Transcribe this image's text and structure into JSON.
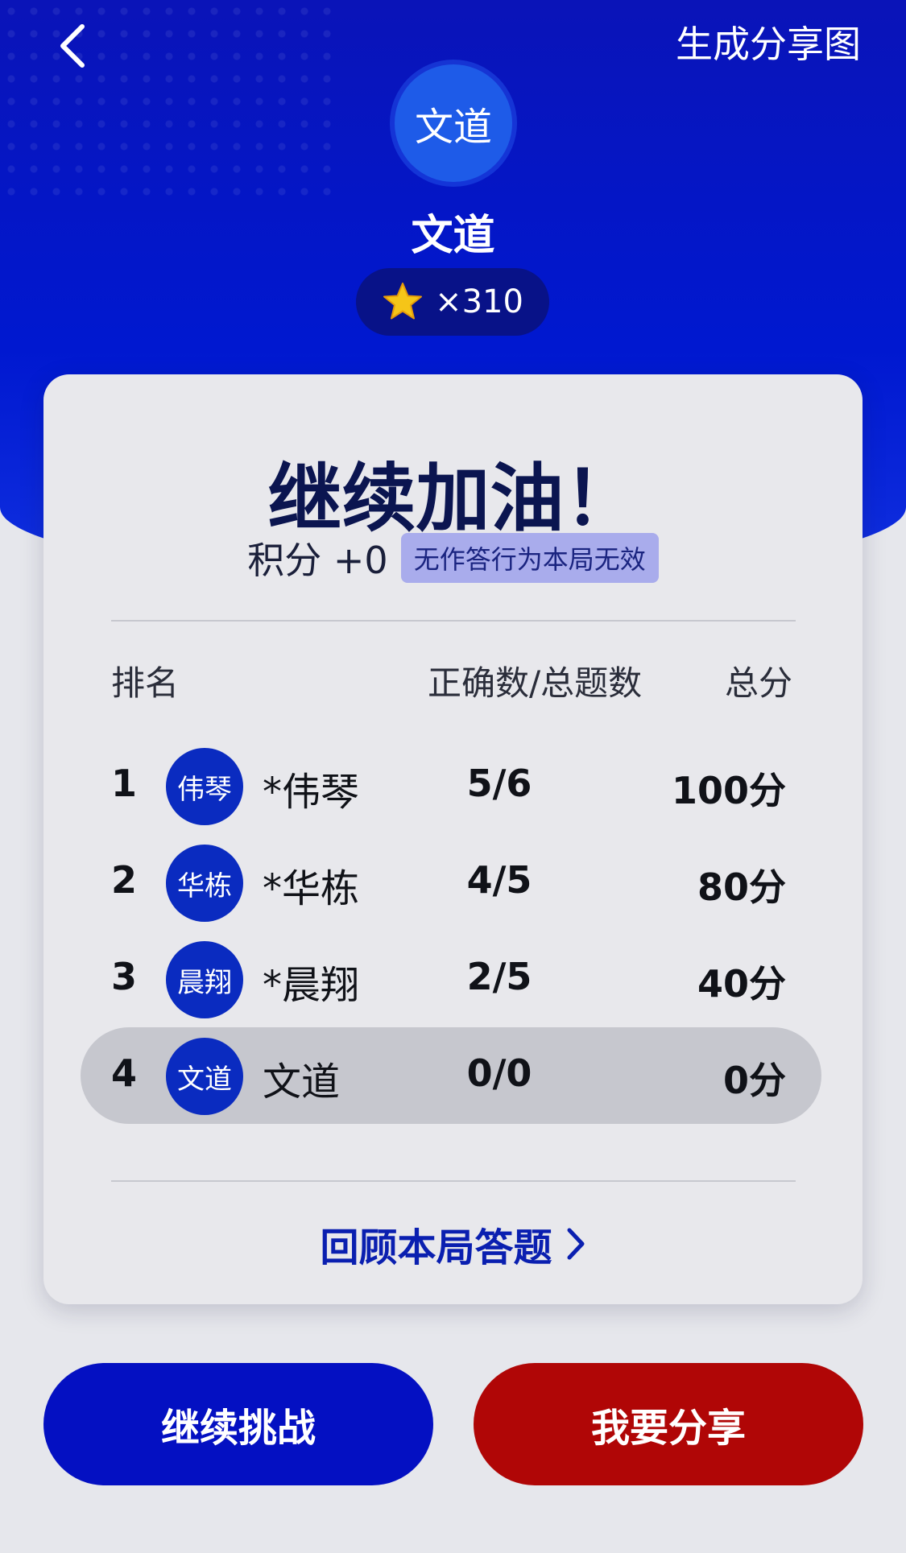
{
  "header": {
    "share_image_label": "生成分享图",
    "avatar_text": "文道",
    "username": "文道",
    "coin_count": "×310"
  },
  "result": {
    "title": "继续加油！",
    "score_label": "积分 +0",
    "score_note": "无作答行为本局无效"
  },
  "table": {
    "headers": {
      "rank": "排名",
      "correct": "正确数/总题数",
      "total": "总分"
    },
    "rows": [
      {
        "rank": "1",
        "avatar": "伟琴",
        "name": "*伟琴",
        "correct": "5/6",
        "score": "100分"
      },
      {
        "rank": "2",
        "avatar": "华栋",
        "name": "*华栋",
        "correct": "4/5",
        "score": "80分"
      },
      {
        "rank": "3",
        "avatar": "晨翔",
        "name": "*晨翔",
        "correct": "2/5",
        "score": "40分"
      },
      {
        "rank": "4",
        "avatar": "文道",
        "name": "文道",
        "correct": "0/0",
        "score": "0分"
      }
    ]
  },
  "review_label": "回顾本局答题",
  "buttons": {
    "continue": "继续挑战",
    "share": "我要分享"
  },
  "colors": {
    "header_blue": "#0018d0",
    "continue_button": "#0410c2",
    "share_button": "#b00606",
    "coin_star": "#f5c518"
  },
  "icons": {
    "back": "chevron-left-icon",
    "coin": "star-icon",
    "review": "chevron-right-icon"
  }
}
